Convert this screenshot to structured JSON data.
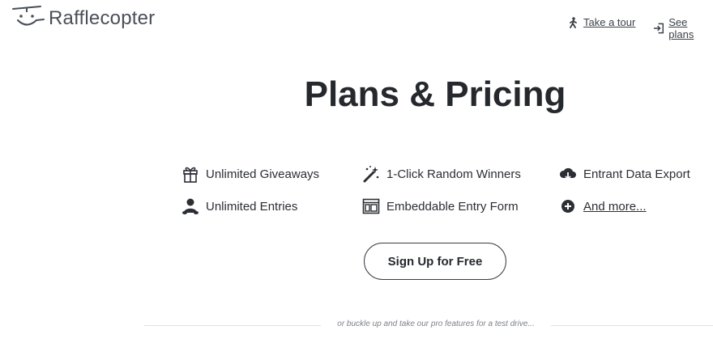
{
  "header": {
    "brand": "Rafflecopter",
    "nav": [
      {
        "label": "Take a tour",
        "icon": "walking-person-icon"
      },
      {
        "label": "See plans",
        "icon": "sign-in-icon"
      }
    ]
  },
  "main": {
    "title": "Plans & Pricing",
    "features": [
      {
        "label": "Unlimited Giveaways",
        "icon": "gift-icon"
      },
      {
        "label": "1-Click Random Winners",
        "icon": "magic-wand-icon"
      },
      {
        "label": "Entrant Data Export",
        "icon": "cloud-download-icon"
      },
      {
        "label": "Unlimited Entries",
        "icon": "user-group-icon"
      },
      {
        "label": "Embeddable Entry Form",
        "icon": "embed-form-icon"
      },
      {
        "label": "And more...",
        "icon": "plus-circle-icon"
      }
    ],
    "signup_label": "Sign Up for Free",
    "divider_text": "or buckle up and take our pro features for a test drive..."
  },
  "colors": {
    "text": "#2b2e34",
    "title": "#25282d",
    "muted": "#7c8088",
    "divider": "#e0e2e6"
  }
}
